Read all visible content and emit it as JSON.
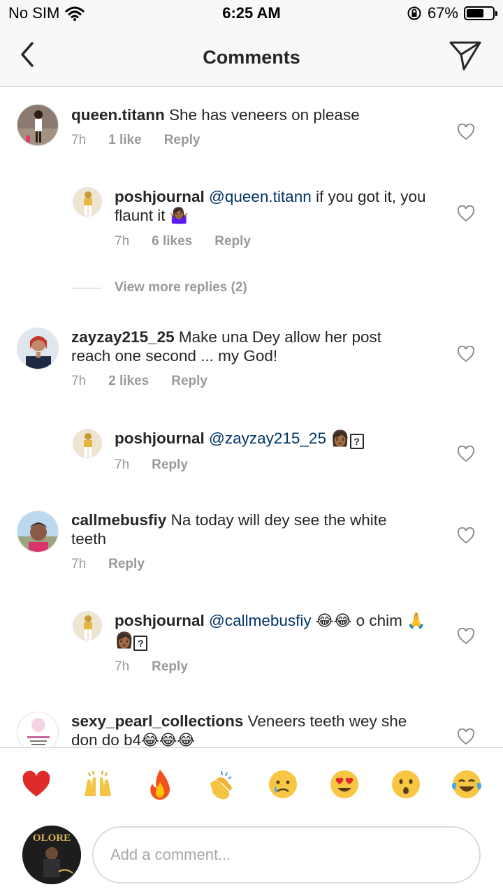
{
  "status_bar": {
    "carrier": "No SIM",
    "time": "6:25 AM",
    "battery": "67%"
  },
  "nav": {
    "title": "Comments"
  },
  "comments": [
    {
      "username": "queen.titann",
      "text": "She has veneers on please",
      "time": "7h",
      "likes": "1 like",
      "reply": "Reply"
    },
    {
      "username": "poshjournal",
      "mention": "@queen.titann",
      "text": "if you got it, you flaunt it",
      "emoji": "🤷🏾‍♀️",
      "time": "7h",
      "likes": "6 likes",
      "reply": "Reply"
    },
    {
      "username": "zayzay215_25",
      "text": "Make una Dey allow her post reach one second ... my God!",
      "time": "7h",
      "likes": "2 likes",
      "reply": "Reply"
    },
    {
      "username": "poshjournal",
      "mention": "@zayzay215_25",
      "emoji": "👩🏾",
      "time": "7h",
      "reply": "Reply"
    },
    {
      "username": "callmebusfiy",
      "text": "Na today will dey see the white teeth",
      "time": "7h",
      "reply": "Reply"
    },
    {
      "username": "poshjournal",
      "mention": "@callmebusfiy",
      "emoji_a": "😂😂",
      "text": "o chim",
      "emoji_b": "🙏👩🏾",
      "time": "7h",
      "reply": "Reply"
    },
    {
      "username": "sexy_pearl_collections",
      "text": "Veneers teeth wey she don do b4",
      "emoji": "😂😂😂"
    }
  ],
  "view_more": "View more replies (2)",
  "reactions": [
    "heart",
    "raised-hands",
    "fire",
    "clapping-hands",
    "crying-face",
    "heart-eyes-face",
    "surprised-face",
    "tears-of-joy-face"
  ],
  "composer": {
    "placeholder": "Add a comment..."
  },
  "colors": {
    "mention": "#003569",
    "meta": "#999999",
    "text": "#262626"
  }
}
